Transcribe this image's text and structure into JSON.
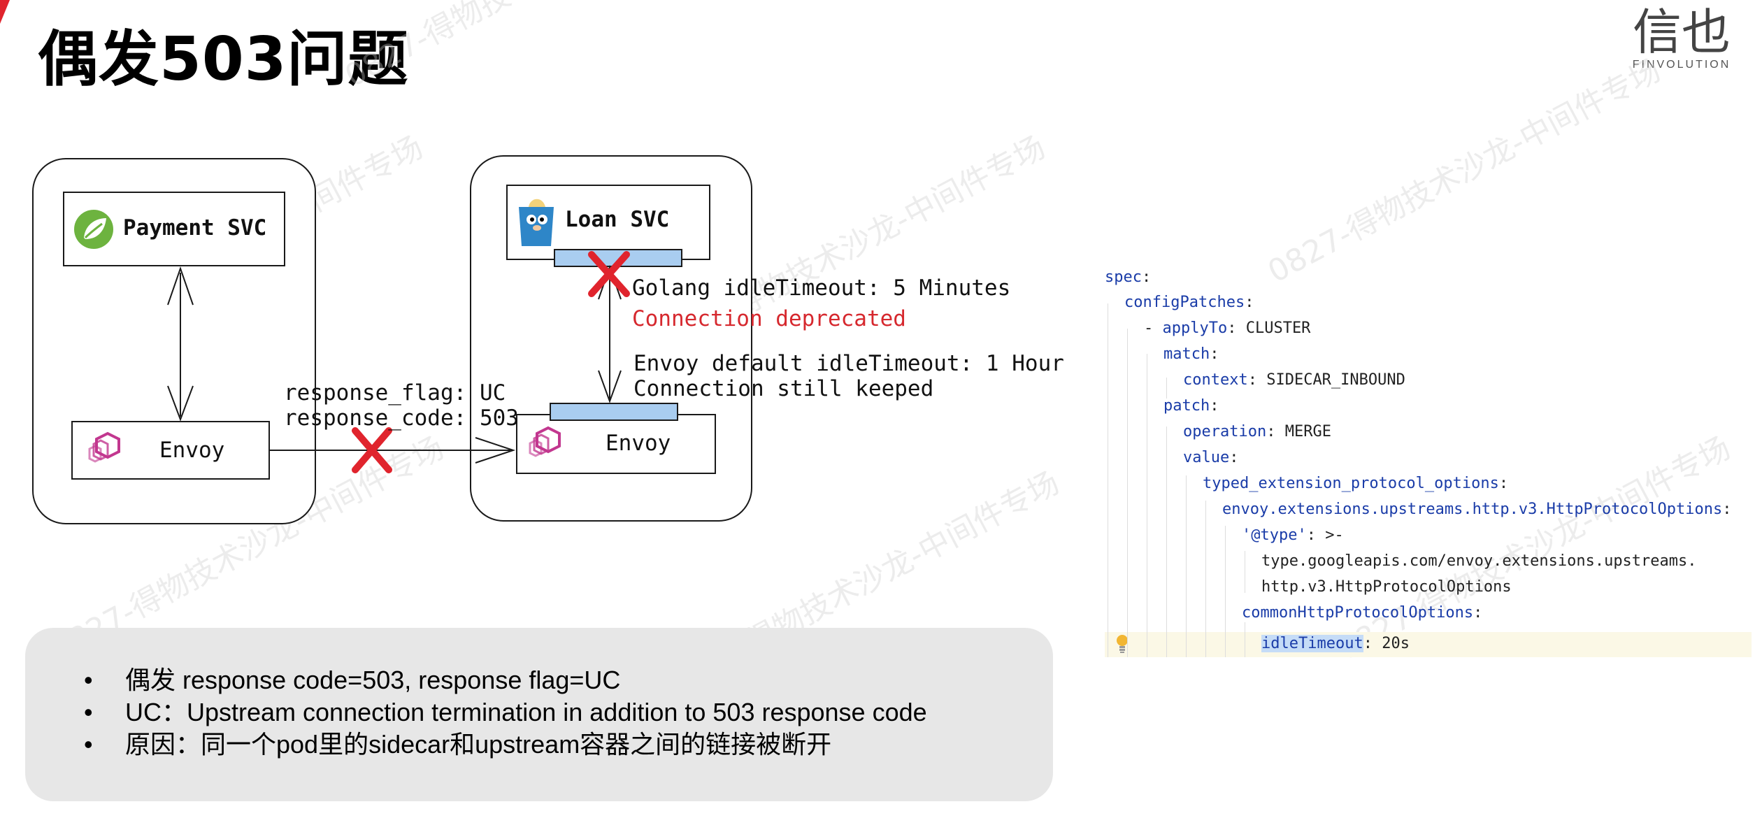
{
  "title": "偶发503问题",
  "logo": {
    "mark": "信也",
    "sub": "FINVOLUTION"
  },
  "watermark": "0827-得物技术沙龙-中间件专场",
  "diagram": {
    "payment_svc": "Payment SVC",
    "loan_svc": "Loan SVC",
    "envoy_left": "Envoy",
    "envoy_right": "Envoy",
    "response_flag": "response_flag: UC",
    "response_code": "response_code: 503",
    "golang_idle": "Golang idleTimeout: 5 Minutes",
    "connection_deprecated": "Connection deprecated",
    "envoy_idle": "Envoy default idleTimeout: 1 Hour",
    "connection_keeped": "Connection still keeped",
    "colors": {
      "error_red": "#e0242d",
      "bar_blue": "#a9cdf0",
      "deprecated_text": "#d6282e"
    }
  },
  "code": {
    "lines": [
      {
        "key": "spec",
        "sep": ":",
        "value": ""
      },
      {
        "key": "configPatches",
        "sep": ":",
        "value": ""
      },
      {
        "prefix": "- ",
        "key": "applyTo",
        "sep": ":",
        "value": " CLUSTER"
      },
      {
        "key": "match",
        "sep": ":",
        "value": ""
      },
      {
        "key": "context",
        "sep": ":",
        "value": " SIDECAR_INBOUND"
      },
      {
        "key": "patch",
        "sep": ":",
        "value": ""
      },
      {
        "key": "operation",
        "sep": ":",
        "value": " MERGE"
      },
      {
        "key": "value",
        "sep": ":",
        "value": ""
      },
      {
        "key": "typed_extension_protocol_options",
        "sep": ":",
        "value": ""
      },
      {
        "key": "envoy.extensions.upstreams.http.v3.HttpProtocolOptions",
        "sep": ":",
        "value": ""
      },
      {
        "key": "'@type'",
        "sep": ":",
        "value": " >-"
      },
      {
        "key": "",
        "sep": "",
        "value": "type.googleapis.com/envoy.extensions.upstreams."
      },
      {
        "key": "",
        "sep": "",
        "value": "http.v3.HttpProtocolOptions"
      },
      {
        "key": "commonHttpProtocolOptions",
        "sep": ":",
        "value": ""
      },
      {
        "key": "idleTimeout",
        "sep": ":",
        "value": " 20s"
      }
    ]
  },
  "notes": [
    "偶发 response code=503, response flag=UC",
    "UC：Upstream connection termination in addition to 503 response code",
    "原因：同一个pod里的sidecar和upstream容器之间的链接被断开"
  ]
}
